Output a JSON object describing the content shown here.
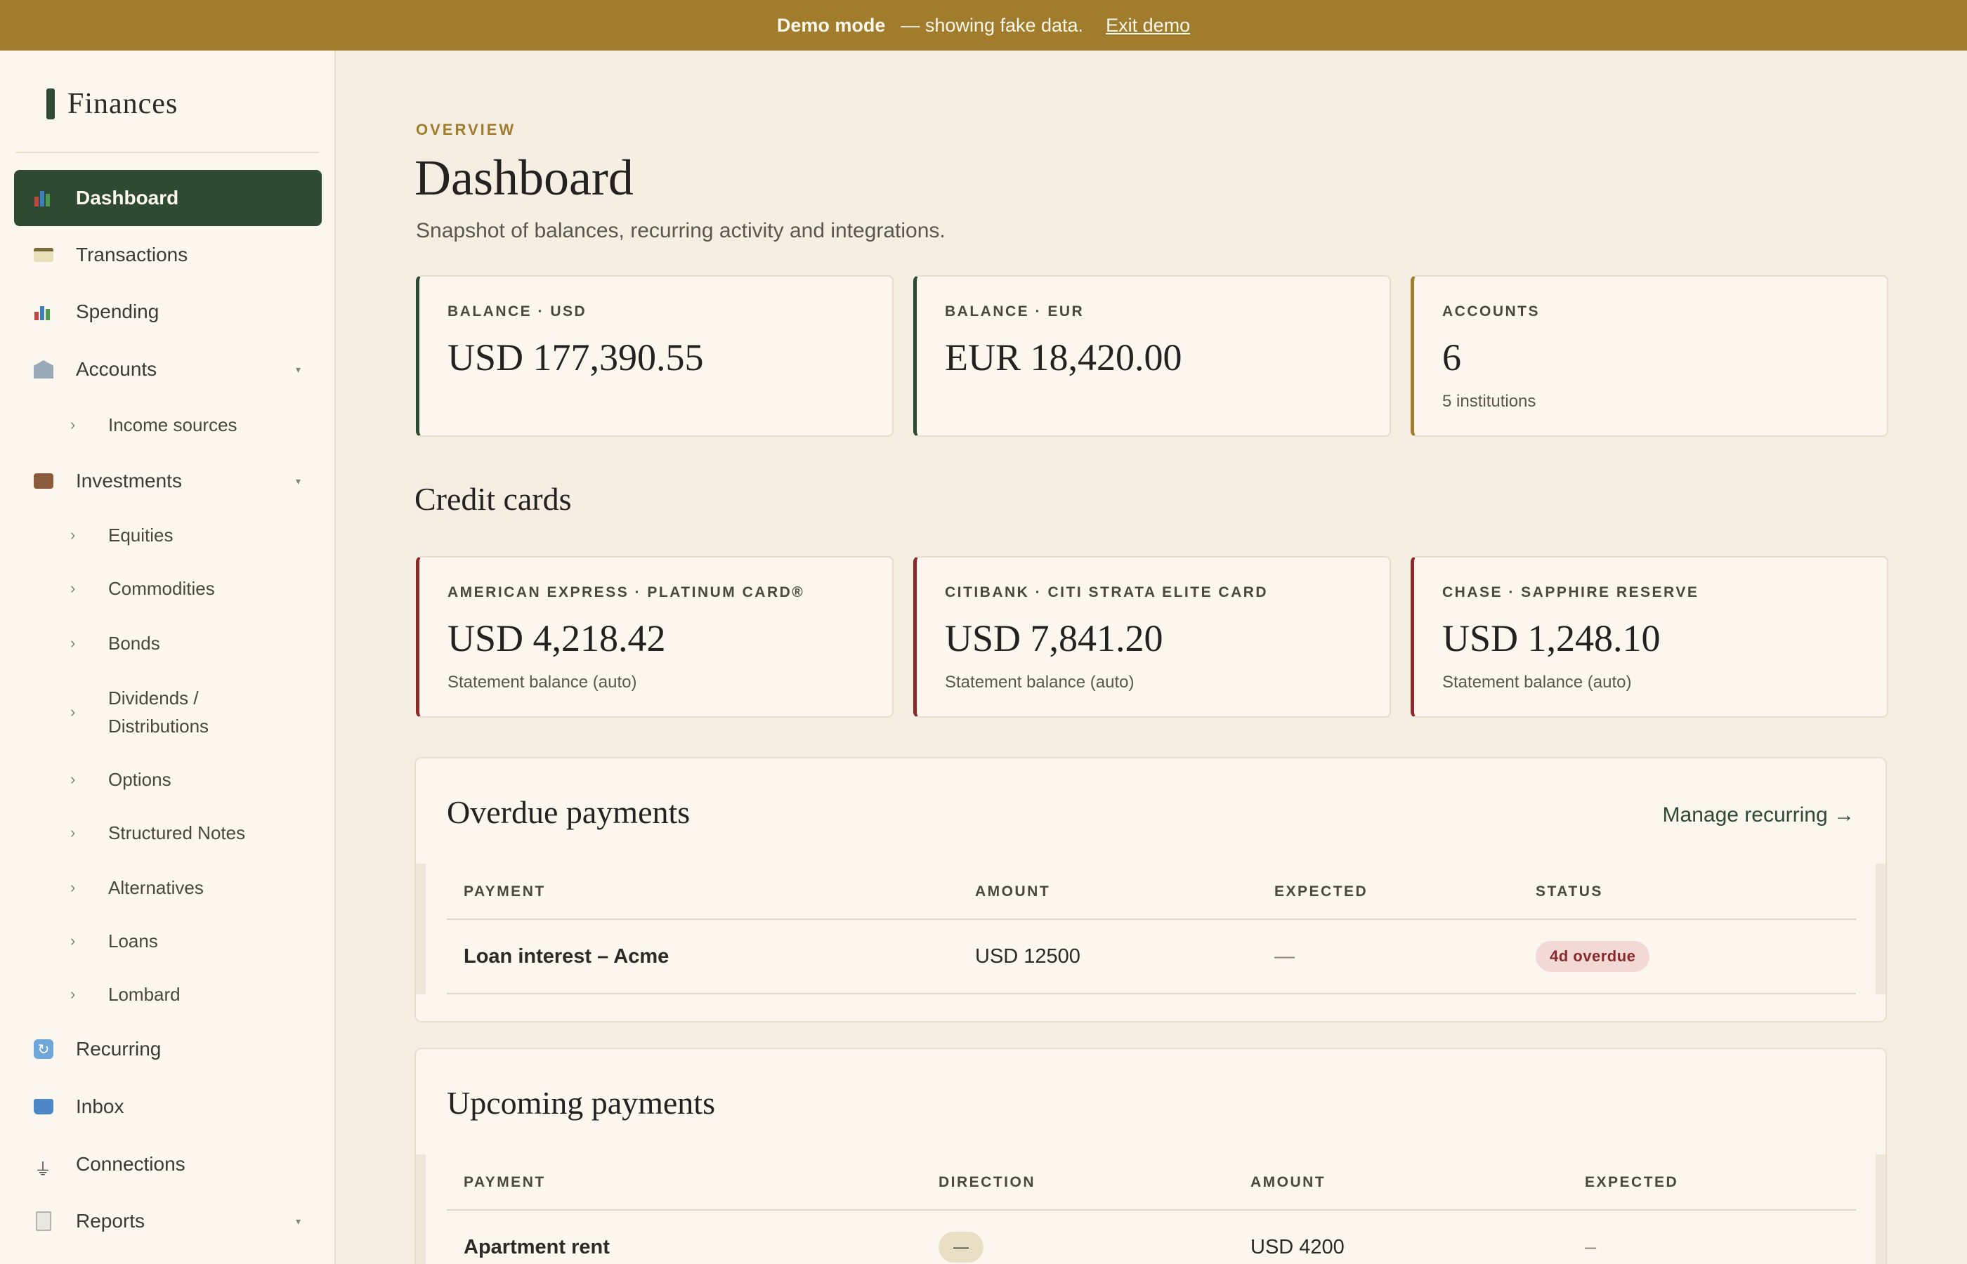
{
  "banner": {
    "mode_label": "Demo mode",
    "message": "— showing fake data.",
    "exit_label": "Exit demo"
  },
  "sidebar": {
    "brand": "Finances",
    "items": [
      {
        "label": "Dashboard",
        "icon": "chart-icon",
        "active": true
      },
      {
        "label": "Transactions",
        "icon": "card-icon"
      },
      {
        "label": "Spending",
        "icon": "chart-icon"
      },
      {
        "label": "Accounts",
        "icon": "bank-icon",
        "expandable": true
      },
      {
        "label": "Investments",
        "icon": "briefcase-icon",
        "expandable": true
      },
      {
        "label": "Recurring",
        "icon": "cycle-icon"
      },
      {
        "label": "Inbox",
        "icon": "inbox-icon"
      },
      {
        "label": "Connections",
        "icon": "plug-icon"
      },
      {
        "label": "Reports",
        "icon": "document-icon",
        "expandable": true
      }
    ],
    "accounts_sub": [
      "Income sources"
    ],
    "investments_sub": [
      "Equities",
      "Commodities",
      "Bonds",
      "Dividends / Distributions",
      "Options",
      "Structured Notes",
      "Alternatives",
      "Loans",
      "Lombard"
    ]
  },
  "header": {
    "eyebrow": "OVERVIEW",
    "title": "Dashboard",
    "subtitle": "Snapshot of balances, recurring activity and integrations."
  },
  "summary_cards": [
    {
      "label": "BALANCE · USD",
      "value": "USD 177,390.55",
      "note": ""
    },
    {
      "label": "BALANCE · EUR",
      "value": "EUR 18,420.00",
      "note": ""
    },
    {
      "label": "ACCOUNTS",
      "value": "6",
      "note": "5 institutions"
    }
  ],
  "credit_cards_title": "Credit cards",
  "credit_cards": [
    {
      "label": "AMERICAN EXPRESS · PLATINUM CARD®",
      "value": "USD 4,218.42",
      "note": "Statement balance (auto)"
    },
    {
      "label": "CITIBANK · CITI STRATA ELITE CARD",
      "value": "USD 7,841.20",
      "note": "Statement balance (auto)"
    },
    {
      "label": "CHASE · SAPPHIRE RESERVE",
      "value": "USD 1,248.10",
      "note": "Statement balance (auto)"
    }
  ],
  "overdue": {
    "title": "Overdue payments",
    "link": "Manage recurring →",
    "columns": [
      "PAYMENT",
      "AMOUNT",
      "EXPECTED",
      "STATUS"
    ],
    "rows": [
      {
        "payment": "Loan interest – Acme",
        "amount": "USD 12500",
        "expected": "—",
        "status": "4d overdue"
      }
    ]
  },
  "upcoming": {
    "title": "Upcoming payments",
    "columns": [
      "PAYMENT",
      "DIRECTION",
      "AMOUNT",
      "EXPECTED"
    ],
    "rows": [
      {
        "payment": "Apartment rent",
        "direction": "—",
        "amount": "USD 4200",
        "expected": "–"
      }
    ]
  },
  "colors": {
    "banner": "#a17c2c",
    "accent_green": "#2f4a32",
    "accent_gold": "#a17c2c",
    "accent_red": "#8a2b2b",
    "background": "#f5efe3"
  }
}
